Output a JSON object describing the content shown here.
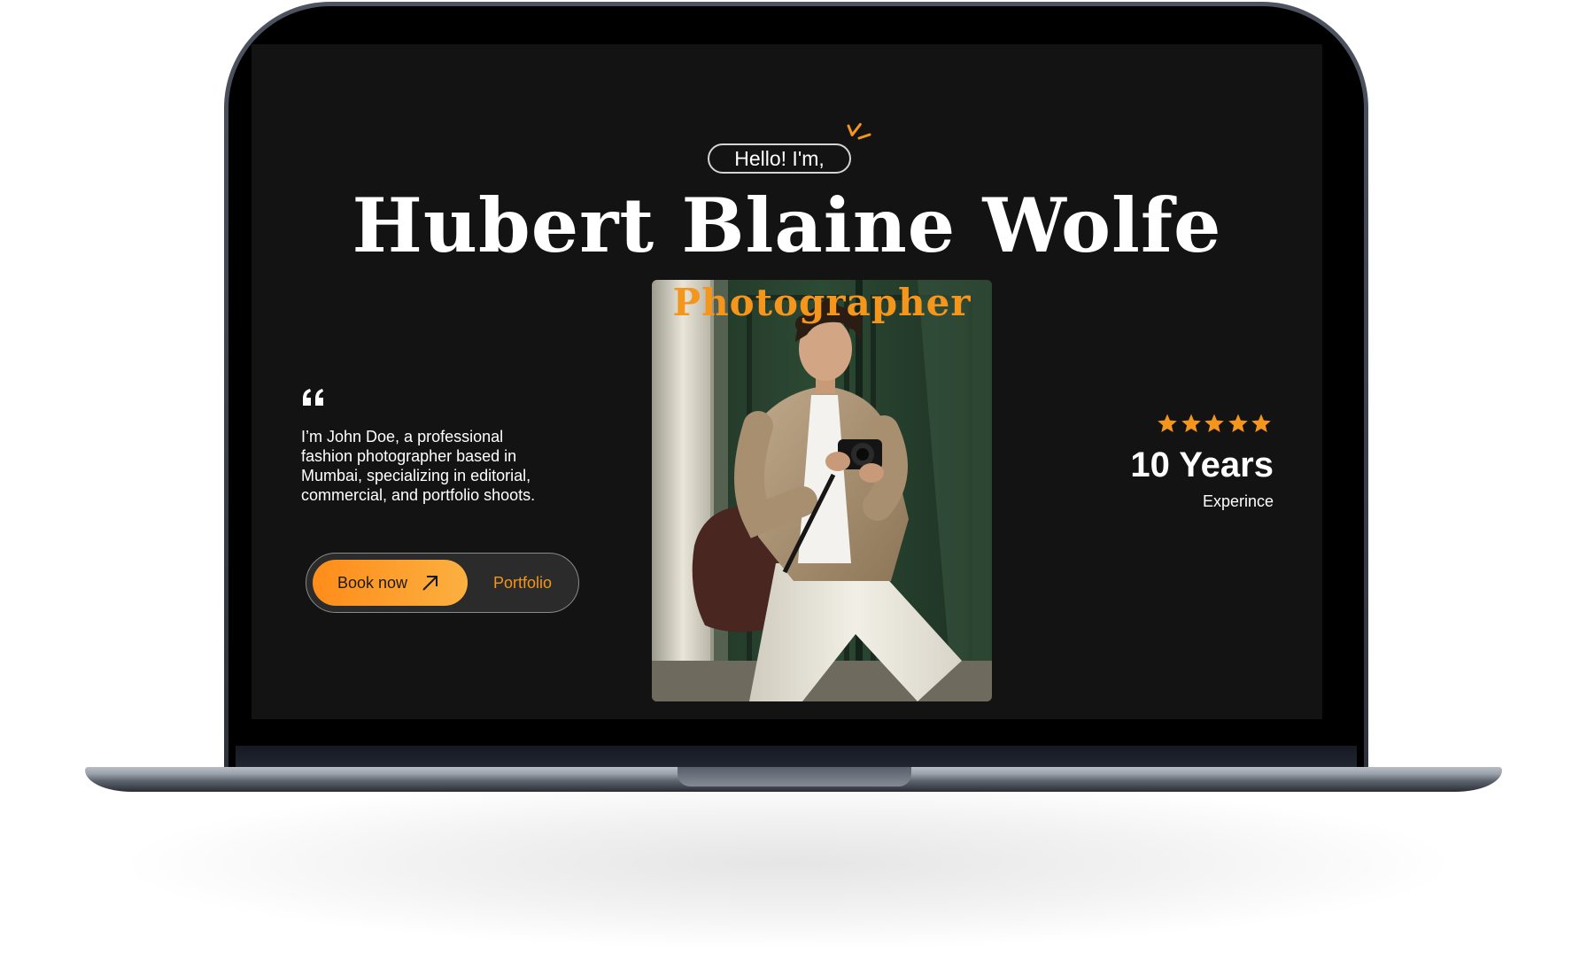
{
  "hero": {
    "greeting": "Hello! I'm,",
    "name": "Hubert Blaine Wolfe",
    "role": "Photographer",
    "bio": "I’m John Doe, a professional fashion photographer based in Mumbai, specializing in editorial, commercial, and portfolio shoots.",
    "quote_icon": "quote-icon",
    "accent_color": "#f4951c"
  },
  "actions": {
    "book_label": "Book now",
    "book_icon": "arrow-up-right-icon",
    "portfolio_label": "Portfolio"
  },
  "stats": {
    "rating": 5,
    "rating_max": 5,
    "years": "10 Years",
    "experience_label": "Experince"
  },
  "photo": {
    "subject": "photographer-portrait"
  }
}
